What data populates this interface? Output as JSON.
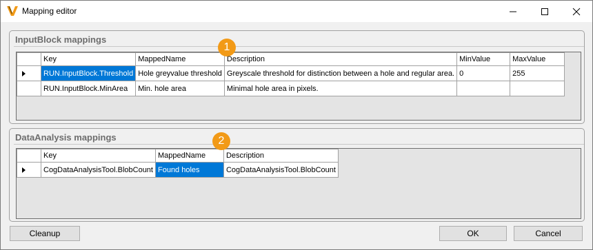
{
  "window": {
    "title": "Mapping editor"
  },
  "input_block": {
    "title": "InputBlock mappings",
    "badge": "1",
    "columns": [
      "Key",
      "MappedName",
      "Description",
      "MinValue",
      "MaxValue"
    ],
    "rows": [
      {
        "key": "RUN.InputBlock.Threshold",
        "mapped_name": "Hole greyvalue threshold",
        "description": "Greyscale threshold for distinction between a hole and regular area.",
        "min": "0",
        "max": "255"
      },
      {
        "key": "RUN.InputBlock.MinArea",
        "mapped_name": "Min. hole area",
        "description": "Minimal hole area in pixels.",
        "min": "",
        "max": ""
      }
    ]
  },
  "data_analysis": {
    "title": "DataAnalysis mappings",
    "badge": "2",
    "columns": [
      "Key",
      "MappedName",
      "Description"
    ],
    "rows": [
      {
        "key": "CogDataAnalysisTool.BlobCount",
        "mapped_name": "Found holes",
        "description": "CogDataAnalysisTool.BlobCount"
      }
    ]
  },
  "buttons": {
    "cleanup": "Cleanup",
    "ok": "OK",
    "cancel": "Cancel"
  },
  "colors": {
    "accent": "#0078d7",
    "badge": "#f29a17"
  }
}
